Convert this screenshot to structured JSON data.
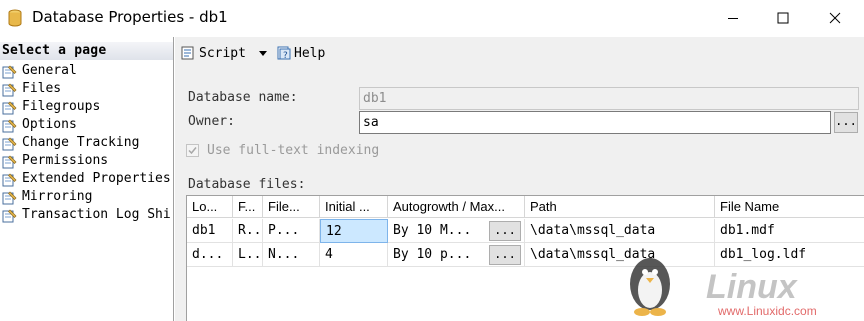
{
  "window": {
    "title": "Database Properties - db1"
  },
  "left_pane": {
    "header": "Select a page",
    "pages": [
      "General",
      "Files",
      "Filegroups",
      "Options",
      "Change Tracking",
      "Permissions",
      "Extended Properties",
      "Mirroring",
      "Transaction Log Shi"
    ]
  },
  "toolbar": {
    "script_label": "Script",
    "help_label": "Help"
  },
  "form": {
    "db_name_label": "Database name:",
    "db_name_value": "db1",
    "owner_label": "Owner:",
    "owner_value": "sa",
    "owner_button": "...",
    "fulltext_label": "Use full-text indexing",
    "fulltext_checked": true,
    "files_label": "Database files:"
  },
  "grid": {
    "columns": [
      "Lo...",
      "F...",
      "File...",
      "Initial ...",
      "Autogrowth / Max...",
      "Path",
      "File Name"
    ],
    "rows": [
      [
        "db1",
        "R...",
        "P...",
        "12",
        "By 10 M...",
        "\\data\\mssql_data",
        "db1.mdf"
      ],
      [
        "d...",
        "L...",
        "N...",
        "4",
        "By 10 p...",
        "\\data\\mssql_data",
        "db1_log.ldf"
      ]
    ],
    "ellipsis": "..."
  },
  "watermark": {
    "brand": "Linux",
    "site": "www.Linuxidc.com"
  },
  "colors": {
    "selected_cell": "#cce8ff",
    "pane_bg": "#f0f0f0",
    "db_icon": "#e8b84a"
  }
}
